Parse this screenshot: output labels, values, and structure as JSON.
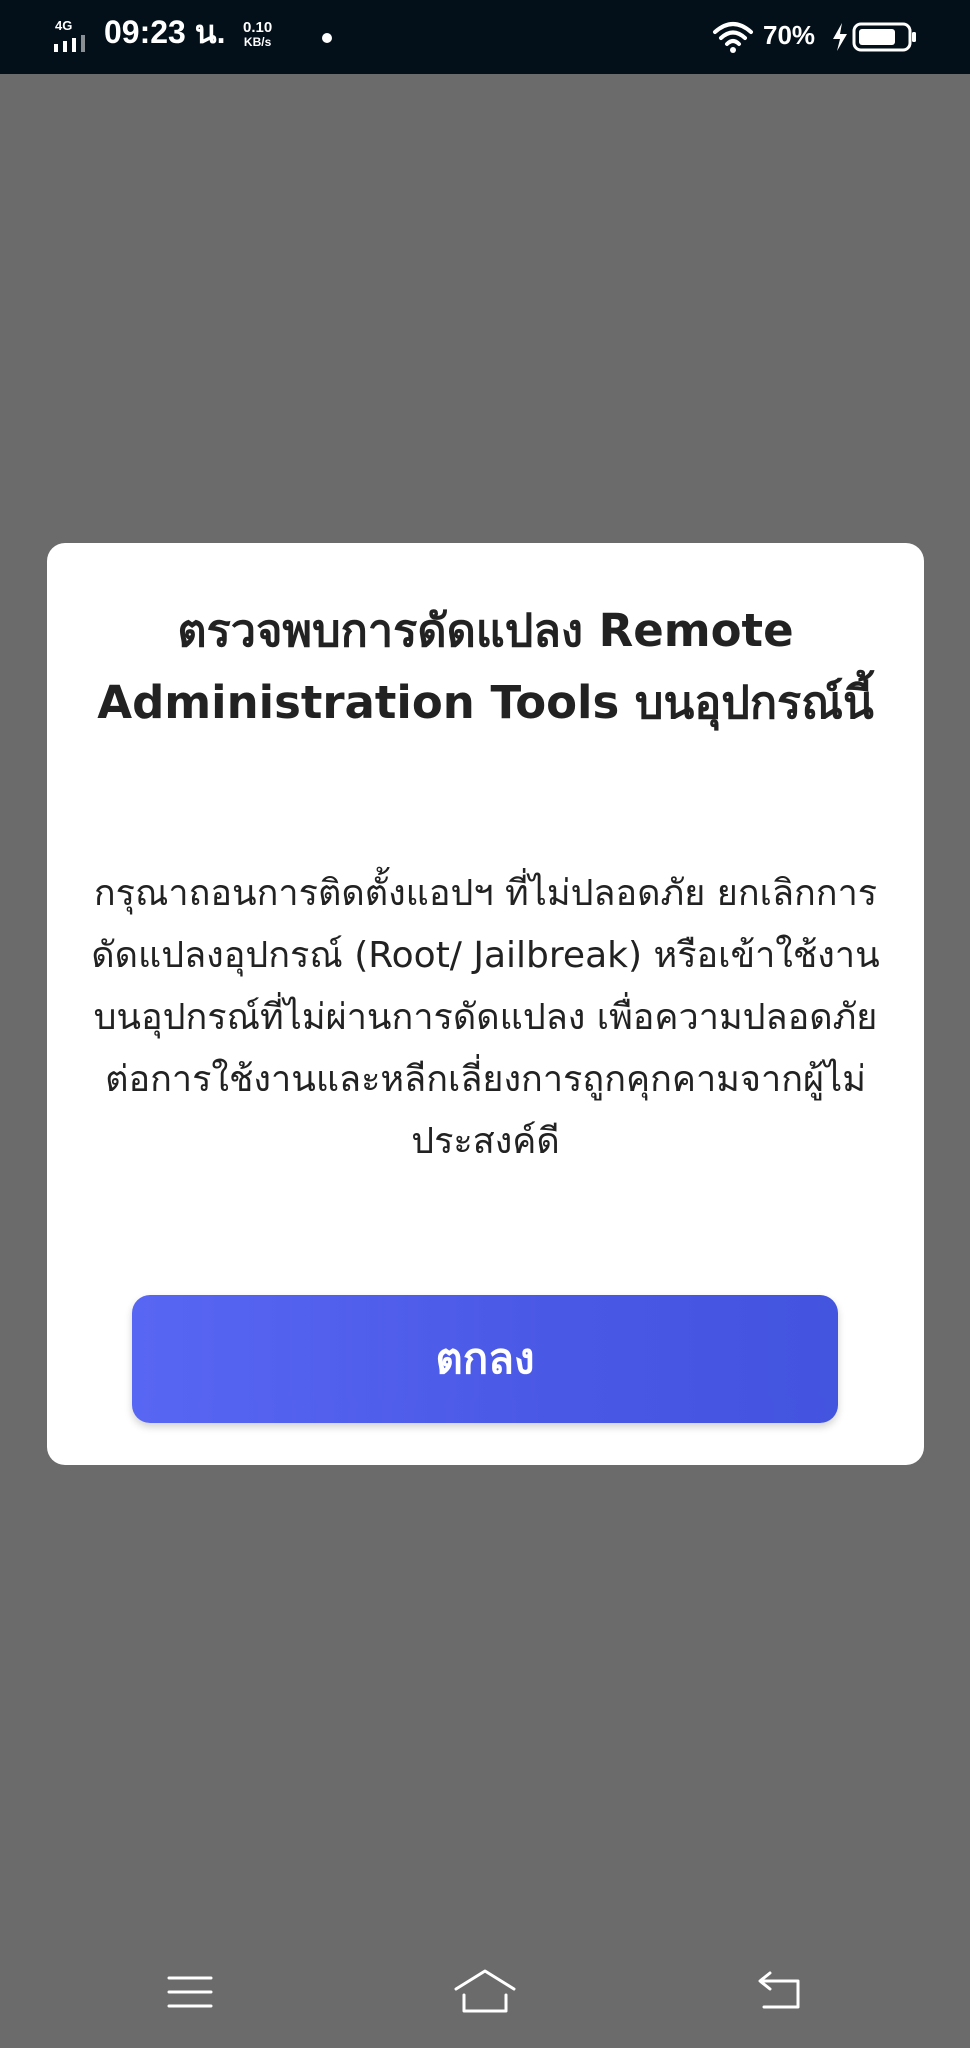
{
  "status_bar": {
    "network_type": "4G",
    "time": "09:23 น.",
    "speed_value": "0.10",
    "speed_unit": "KB/s",
    "battery_percent": "70%",
    "icons": [
      "signal-icon",
      "wifi-icon",
      "charging-bolt-icon",
      "battery-icon"
    ]
  },
  "dialog": {
    "title": "ตรวจพบการดัดแปลง Remote Administration Tools บนอุปกรณ์นี้",
    "message": "กรุณาถอนการติดตั้งแอปฯ ที่ไม่ปลอดภัย ยกเลิกการดัดแปลงอุปกรณ์ (Root/ Jailbreak) หรือเข้าใช้งานบนอุปกรณ์ที่ไม่ผ่านการดัดแปลง เพื่อความปลอดภัยต่อการใช้งานและหลีกเลี่ยงการถูกคุกคามจากผู้ไม่ประสงค์ดี",
    "ok_label": "ตกลง"
  },
  "nav_bar": {
    "icons": [
      "menu-icon",
      "home-icon",
      "back-icon"
    ]
  },
  "colors": {
    "status_bar_bg": "#031019",
    "overlay_bg": "#6b6b6b",
    "dialog_bg": "#ffffff",
    "button_bg": "#4f5ded",
    "button_text": "#ffffff",
    "text": "#222222"
  }
}
